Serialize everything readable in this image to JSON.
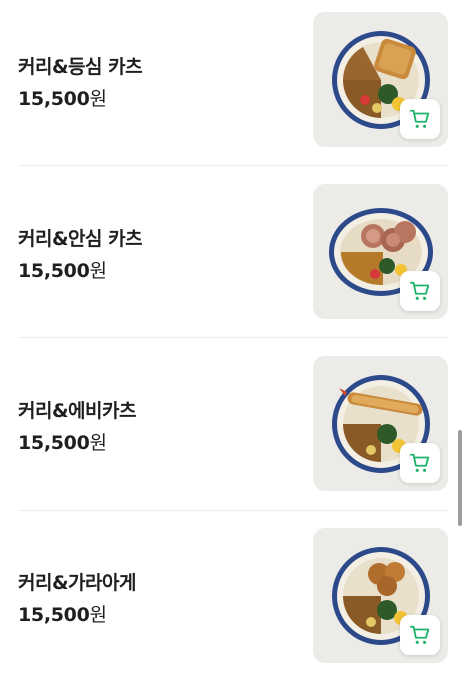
{
  "menu": {
    "items": [
      {
        "name": "커리&등심 카츠",
        "price": "15,500",
        "currency": "원",
        "topping": "cutlet",
        "image_icon": "food-photo",
        "cart_icon": "cart-icon"
      },
      {
        "name": "커리&안심 카츠",
        "price": "15,500",
        "currency": "원",
        "topping": "fillet",
        "image_icon": "food-photo",
        "cart_icon": "cart-icon"
      },
      {
        "name": "커리&에비카츠",
        "price": "15,500",
        "currency": "원",
        "topping": "shrimp",
        "image_icon": "food-photo",
        "cart_icon": "cart-icon"
      },
      {
        "name": "커리&가라아게",
        "price": "15,500",
        "currency": "원",
        "topping": "karaage",
        "image_icon": "food-photo",
        "cart_icon": "cart-icon"
      }
    ]
  },
  "colors": {
    "accent": "#1db46a",
    "text": "#1f1f1f",
    "thumb_bg": "#ecebe8",
    "divider": "#ececec"
  }
}
